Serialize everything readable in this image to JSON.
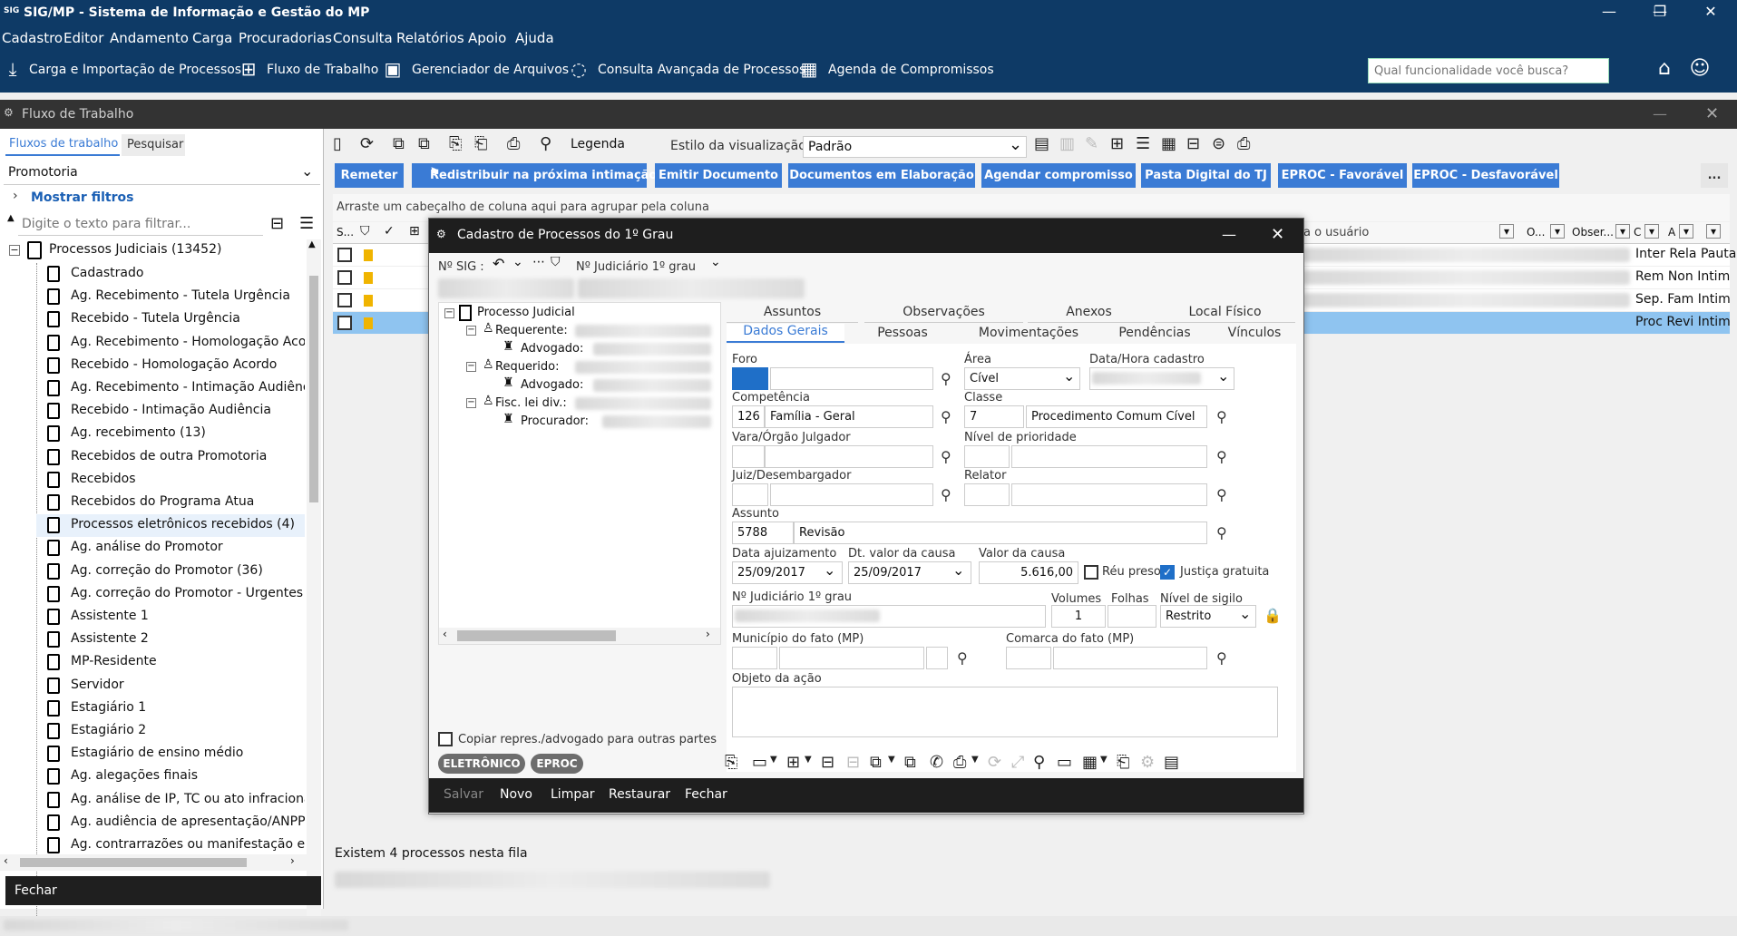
{
  "app": {
    "title": "SIG/MP - Sistema de Informação e Gestão do MP",
    "logo": "SIG"
  },
  "menu": [
    "Cadastro",
    "Editor",
    "Andamento",
    "Carga",
    "Procuradorias",
    "Consulta",
    "Relatórios",
    "Apoio",
    "Ajuda"
  ],
  "toolbar": {
    "items": [
      {
        "label": "Carga e Importação de Processos",
        "icon": "download-icon"
      },
      {
        "label": "Fluxo de Trabalho",
        "icon": "workflow-icon"
      },
      {
        "label": "Gerenciador de Arquivos",
        "icon": "file-manager-icon"
      },
      {
        "label": "Consulta Avançada de Processos",
        "icon": "search-chat-icon"
      },
      {
        "label": "Agenda de Compromissos",
        "icon": "calendar-icon"
      }
    ],
    "search_placeholder": "Qual funcionalidade você busca?"
  },
  "subwindow": {
    "title": "Fluxo de Trabalho"
  },
  "left": {
    "tabs": [
      "Fluxos de trabalho",
      "Pesquisar"
    ],
    "selected_flow": "Promotoria",
    "show_filters": "Mostrar filtros",
    "filter_placeholder": "Digite o texto para filtrar...",
    "root": "Processos Judiciais (13452)",
    "items": [
      "Cadastrado",
      "Ag. Recebimento - Tutela Urgência",
      "Recebido - Tutela Urgência",
      "Ag. Recebimento - Homologação Acor",
      "Recebido - Homologação Acordo",
      "Ag. Recebimento - Intimação Audiênci",
      "Recebido - Intimação Audiência",
      "Ag. recebimento (13)",
      "Recebidos de outra Promotoria",
      "Recebidos",
      "Recebidos do Programa Atua",
      "Processos eletrônicos recebidos (4)",
      "Ag. análise do Promotor",
      "Ag. correção do Promotor (36)",
      "Ag. correção do Promotor - Urgentes",
      "Assistente 1",
      "Assistente 2",
      "MP-Residente",
      "Servidor",
      "Estagiário 1",
      "Estagiário 2",
      "Estagiário de ensino médio",
      "Ag. alegações finais",
      "Ag. análise de IP, TC ou ato infracional",
      "Ag. audiência de apresentação/ANPP",
      "Ag. contrarrazões ou manifestação em"
    ],
    "close": "Fechar"
  },
  "content": {
    "legend": "Legenda",
    "view_style_label": "Estilo da visualização",
    "view_style": "Padrão",
    "buttons": [
      "Remeter",
      "Redistribuir na próxima intimação",
      "Emitir Documento",
      "Documentos em Elaboração",
      "Agendar compromisso",
      "Pasta Digital do TJ",
      "EPROC - Favorável",
      "EPROC - Desfavorável"
    ],
    "more": "...",
    "group_hint": "Arraste um cabeçalho de coluna aqui para agrupar pela coluna",
    "headers": {
      "s": "S...",
      "user": "a o usuário",
      "o": "O...",
      "obs": "Obser...",
      "c": "C",
      "a": "A"
    },
    "rows": [
      [
        "Inter",
        "Rela",
        "Pauta"
      ],
      [
        "Rem",
        "Non",
        "Intim"
      ],
      [
        "Sep.",
        "Fam",
        "Intim"
      ],
      [
        "Proc",
        "Revi",
        "Intim"
      ]
    ],
    "status": "Existem 4 processos nesta fila"
  },
  "modal": {
    "title": "Cadastro de Processos do 1º Grau",
    "sig_label": "Nº SIG :",
    "jud_label": "Nº Judiciário   1º grau",
    "tree": {
      "root": "Processo Judicial",
      "requerente": "Requerente:",
      "advogado1": "Advogado:",
      "requerido": "Requerido:",
      "advogado2": "Advogado:",
      "fisc": "Fisc. lei div.:",
      "procurador": "Procurador:"
    },
    "copy_label": "Copiar repres./advogado para outras partes",
    "pills": [
      "ELETRÔNICO",
      "EPROC"
    ],
    "tabs_top": [
      "Assuntos",
      "Observações",
      "Anexos",
      "Local Físico"
    ],
    "tabs_bottom": [
      "Dados Gerais",
      "Pessoas",
      "Movimentações",
      "Pendências",
      "Vínculos"
    ],
    "fields": {
      "foro": "Foro",
      "area": "Área",
      "area_value": "Cível",
      "data_hora": "Data/Hora cadastro",
      "competencia": "Competência",
      "comp_code": "126",
      "comp_value": "Família - Geral",
      "classe": "Classe",
      "classe_code": "7",
      "classe_value": "Procedimento Comum Cível",
      "vara": "Vara/Órgão Julgador",
      "nivel_prioridade": "Nível de prioridade",
      "juiz": "Juiz/Desembargador",
      "relator": "Relator",
      "assunto": "Assunto",
      "assunto_code": "5788",
      "assunto_value": "Revisão",
      "data_ajuiz": "Data ajuizamento",
      "data_ajuiz_value": "25/09/2017",
      "dt_valor": "Dt. valor da causa",
      "dt_valor_value": "25/09/2017",
      "valor": "Valor da causa",
      "valor_value": "5.616,00",
      "reu_preso": "Réu preso",
      "justica": "Justiça gratuita",
      "njud": "Nº Judiciário  1º grau",
      "volumes": "Volumes",
      "volumes_value": "1",
      "folhas": "Folhas",
      "sigilo": "Nível de sigilo",
      "sigilo_value": "Restrito",
      "municipio": "Município do fato (MP)",
      "comarca": "Comarca do fato (MP)",
      "objeto": "Objeto da ação"
    },
    "footer": [
      "Salvar",
      "Novo",
      "Limpar",
      "Restaurar",
      "Fechar"
    ]
  },
  "colors": {
    "navy": "#0e3a66",
    "blue_button": "#3a7bd5",
    "selected_row": "#8fc4f0",
    "dark": "#1e1e1e"
  }
}
